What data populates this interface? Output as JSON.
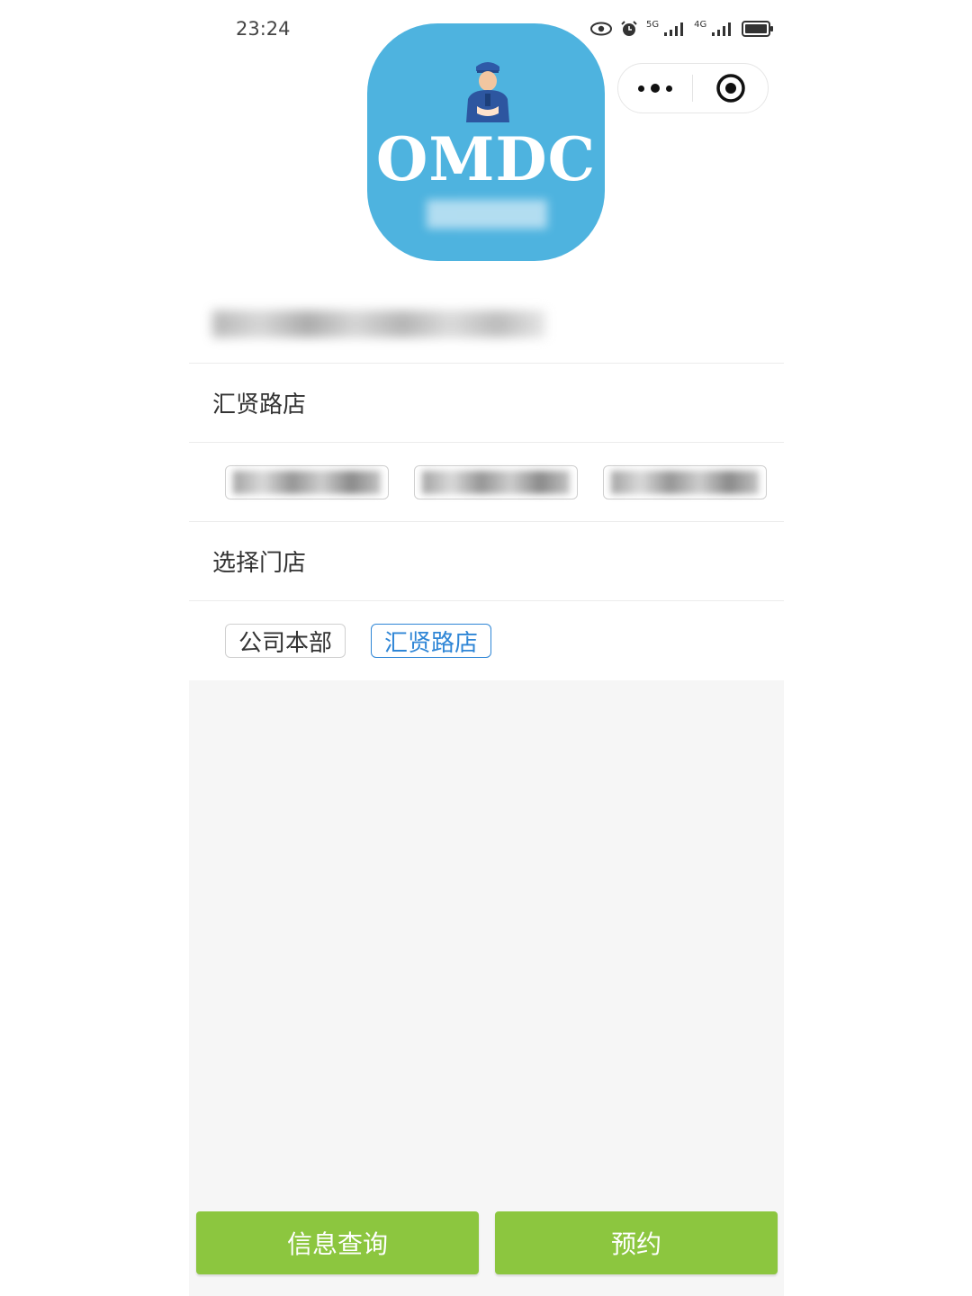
{
  "status_bar": {
    "time": "23:24",
    "signal_1_label": "5G",
    "signal_2_label": "4G",
    "icons": [
      "eye-icon",
      "alarm-icon",
      "signal-5g-icon",
      "signal-4g-icon",
      "battery-icon"
    ]
  },
  "capsule": {
    "icons": [
      "more-icon",
      "close-miniprogram-icon"
    ]
  },
  "logo": {
    "text": "OMDC",
    "background": "#4eb3df"
  },
  "store_section": {
    "current_store": "汇贤路店"
  },
  "store_picker": {
    "title": "选择门店",
    "options": [
      {
        "label": "公司本部",
        "selected": false
      },
      {
        "label": "汇贤路店",
        "selected": true
      }
    ]
  },
  "actions": {
    "query_label": "信息查询",
    "book_label": "预约"
  },
  "colors": {
    "accent_green": "#8cc63f",
    "selected_blue": "#2f86d6"
  }
}
